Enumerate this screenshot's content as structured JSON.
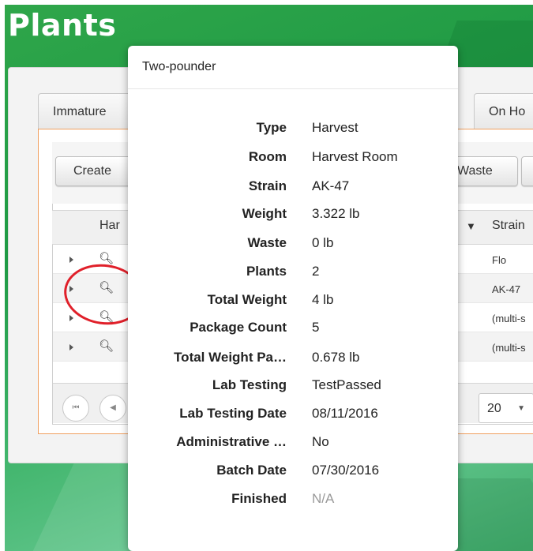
{
  "page": {
    "title": "Plants"
  },
  "tabs": {
    "left": "Immature",
    "right": "On Ho"
  },
  "toolbar": {
    "create_label": "Create",
    "waste_label": "Waste"
  },
  "grid": {
    "header_left": "Har",
    "header_strain": "Strain",
    "rows": [
      {
        "strain": "Flo"
      },
      {
        "strain": "AK-47"
      },
      {
        "strain": "(multi-s"
      },
      {
        "strain": "(multi-s"
      }
    ],
    "page_size": "20"
  },
  "popup": {
    "title": "Two-pounder",
    "fields": [
      {
        "label": "Type",
        "value": "Harvest"
      },
      {
        "label": "Room",
        "value": "Harvest Room"
      },
      {
        "label": "Strain",
        "value": "AK-47"
      },
      {
        "label": "Weight",
        "value": "3.322 lb"
      },
      {
        "label": "Waste",
        "value": "0 lb"
      },
      {
        "label": "Plants",
        "value": "2"
      },
      {
        "label": "Total Weight",
        "value": "4 lb"
      },
      {
        "label": "Package Count",
        "value": "5"
      },
      {
        "label": "Total Weight Pa…",
        "value": "0.678 lb"
      },
      {
        "label": "Lab Testing",
        "value": "TestPassed"
      },
      {
        "label": "Lab Testing Date",
        "value": "08/11/2016"
      },
      {
        "label": "Administrative …",
        "value": "No"
      },
      {
        "label": "Batch Date",
        "value": "07/30/2016"
      },
      {
        "label": "Finished",
        "value": "N/A"
      }
    ]
  },
  "icons": [
    "magnifier-icon",
    "asterisk-icon",
    "gear-icon",
    "filter-icon",
    "chevron-down-icon",
    "first-page-icon",
    "prev-page-icon"
  ],
  "colors": {
    "brand_green": "#2fa64a",
    "annotation_red": "#e0202a",
    "tab_border_orange": "#f0a060"
  }
}
